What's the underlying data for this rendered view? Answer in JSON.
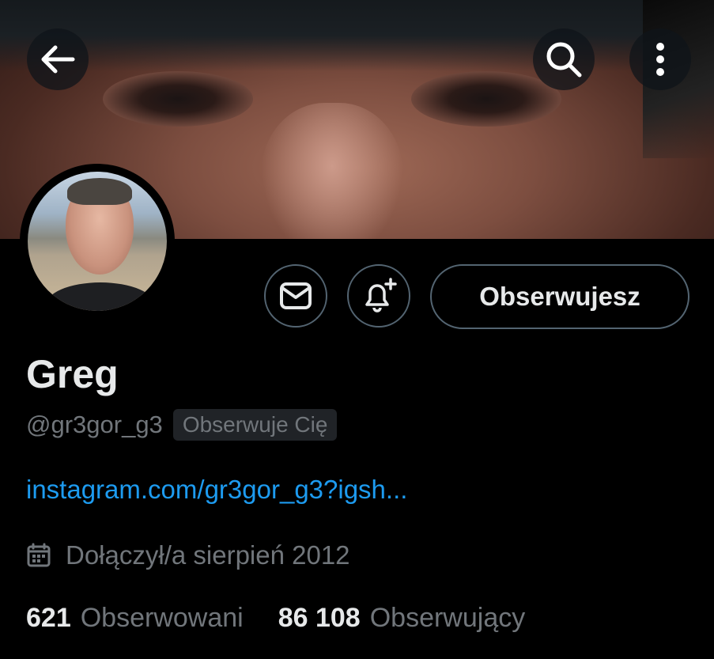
{
  "header": {
    "back_icon": "arrow-left-icon",
    "search_icon": "search-icon",
    "more_icon": "more-vertical-icon"
  },
  "profile": {
    "name": "Greg",
    "handle": "@gr3gor_g3",
    "follows_you_badge": "Obserwuje Cię",
    "link": "instagram.com/gr3gor_g3?igsh...",
    "joined": "Dołączył/a sierpień 2012",
    "joined_icon": "calendar-icon"
  },
  "actions": {
    "message_icon": "mail-icon",
    "notify_icon": "bell-plus-icon",
    "follow_label": "Obserwujesz"
  },
  "stats": {
    "following_count": "621",
    "following_label": "Obserwowani",
    "followers_count": "86 108",
    "followers_label": "Obserwujący"
  },
  "colors": {
    "background": "#000000",
    "text_primary": "#e7e9ea",
    "text_secondary": "#71767b",
    "link": "#1d9bf0",
    "border": "#536471"
  }
}
